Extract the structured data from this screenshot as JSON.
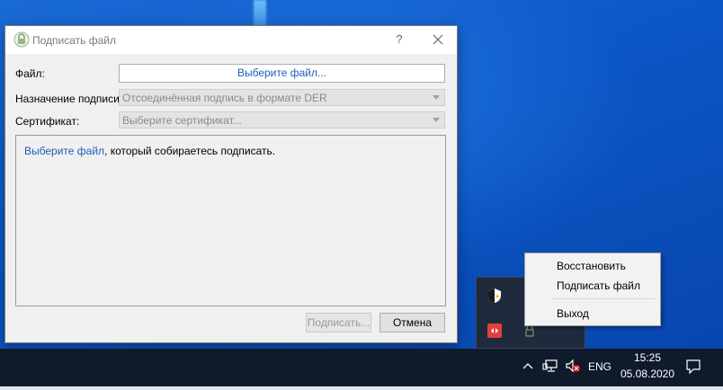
{
  "dialog": {
    "title": "Подписать файл",
    "help_label": "?",
    "file_label": "Файл:",
    "file_button": "Выберите файл...",
    "purpose_label": "Назначение подписи:",
    "purpose_value": "Отсоединённая подпись в формате DER",
    "cert_label": "Сертификат:",
    "cert_value": "Выберите сертификат...",
    "info_link": "Выберите файл",
    "info_rest": ", который собираетесь подписать.",
    "sign_button": "Подписать...",
    "cancel_button": "Отмена"
  },
  "context_menu": {
    "items": [
      "Восстановить",
      "Подписать файл",
      "Выход"
    ]
  },
  "taskbar": {
    "language": "ENG",
    "time": "15:25",
    "date": "05.08.2020"
  },
  "colors": {
    "desktop": "#0a56c4",
    "taskbar": "#0f1a2a",
    "link": "#1e5db8",
    "flyout": "#1f2b3c"
  }
}
